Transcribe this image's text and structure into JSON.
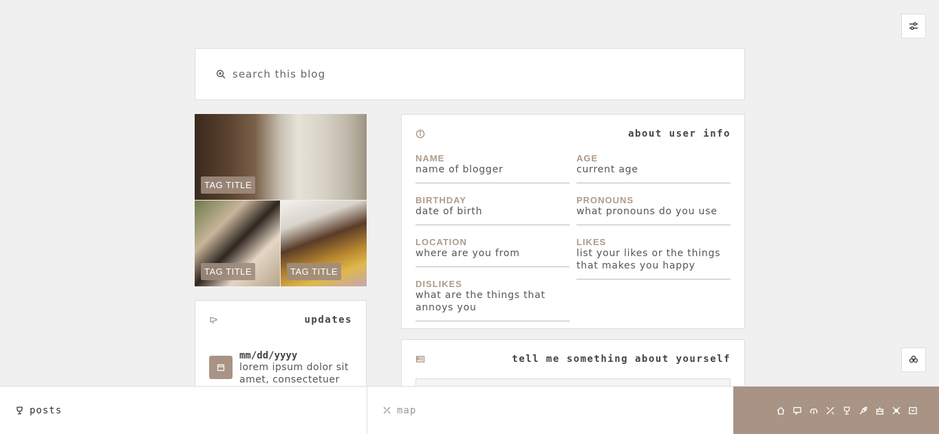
{
  "search": {
    "placeholder": "search this blog"
  },
  "tags": [
    {
      "label": "TAG TITLE"
    },
    {
      "label": "TAG TITLE"
    },
    {
      "label": "TAG TITLE"
    }
  ],
  "updates": {
    "title": "updates",
    "items": [
      {
        "date": "mm/dd/yyyy",
        "text": "lorem ipsum dolor sit amet, consectetuer"
      }
    ]
  },
  "about": {
    "title": "about user info",
    "left": [
      {
        "label": "NAME",
        "value": "name of blogger"
      },
      {
        "label": "BIRTHDAY",
        "value": "date of birth"
      },
      {
        "label": "LOCATION",
        "value": "where are you from"
      },
      {
        "label": "DISLIKES",
        "value": "what are the things that annoys you"
      }
    ],
    "right": [
      {
        "label": "AGE",
        "value": "current age"
      },
      {
        "label": "PRONOUNS",
        "value": "what pronouns do you use"
      },
      {
        "label": "LIKES",
        "value": "list your likes or the things that makes you happy"
      }
    ]
  },
  "tell": {
    "title": "tell me something about yourself"
  },
  "bottom_nav": {
    "posts_label": "posts",
    "map_label": "map",
    "icons": [
      "home-icon",
      "chat-icon",
      "cloud-upload-icon",
      "tools-icon",
      "trophy-icon",
      "rocket-icon",
      "robot-icon",
      "puzzle-icon",
      "archive-icon"
    ]
  },
  "colors": {
    "accent": "#a89384",
    "label": "#b09a88",
    "background": "#f0f0f0"
  }
}
